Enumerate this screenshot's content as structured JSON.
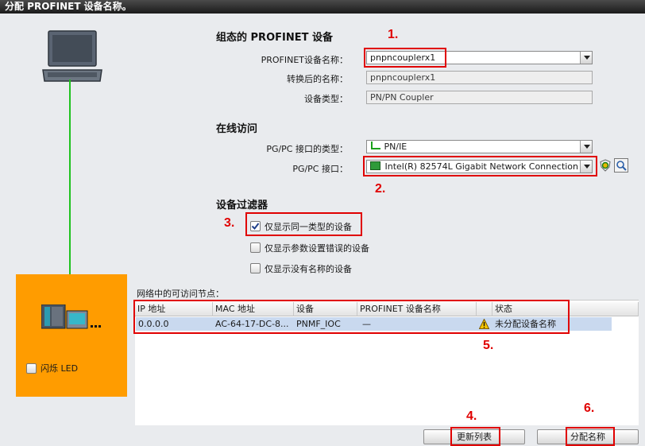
{
  "window": {
    "title": "分配 PROFINET 设备名称。"
  },
  "config_section": {
    "heading": "组态的 PROFINET 设备",
    "device_name_label": "PROFINET设备名称：",
    "device_name_value": "pnpncouplerx1",
    "converted_name_label": "转换后的名称：",
    "converted_name_value": "pnpncouplerx1",
    "device_type_label": "设备类型：",
    "device_type_value": "PN/PN Coupler"
  },
  "online_section": {
    "heading": "在线访问",
    "interface_type_label": "PG/PC 接口的类型：",
    "interface_type_value": "PN/IE",
    "interface_label": "PG/PC 接口：",
    "interface_value": "Intel(R) 82574L Gigabit Network Connection"
  },
  "filter_section": {
    "heading": "设备过滤器",
    "options": [
      {
        "label": "仅显示同一类型的设备",
        "checked": true
      },
      {
        "label": "仅显示参数设置错误的设备",
        "checked": false
      },
      {
        "label": "仅显示没有名称的设备",
        "checked": false
      }
    ]
  },
  "device_panel": {
    "flash_led_label": "闪烁 LED",
    "flash_led_checked": false
  },
  "nodes_table": {
    "caption": "网络中的可访问节点：",
    "columns": [
      "IP 地址",
      "MAC 地址",
      "设备",
      "PROFINET 设备名称",
      "状态"
    ],
    "rows": [
      {
        "ip": "0.0.0.0",
        "mac": "AC-64-17-DC-8...",
        "device": "PNMF_IOC",
        "profinet_name": "—",
        "status": "未分配设备名称"
      }
    ]
  },
  "buttons": {
    "update_list": "更新列表",
    "assign_name": "分配名称"
  },
  "annotations": [
    "1.",
    "2.",
    "3.",
    "4.",
    "5.",
    "6."
  ],
  "colors": {
    "annotation_red": "#e00000",
    "device_panel": "#ff9c00",
    "link_line": "#1fc21f",
    "selected_row": "#c9d9ef"
  }
}
